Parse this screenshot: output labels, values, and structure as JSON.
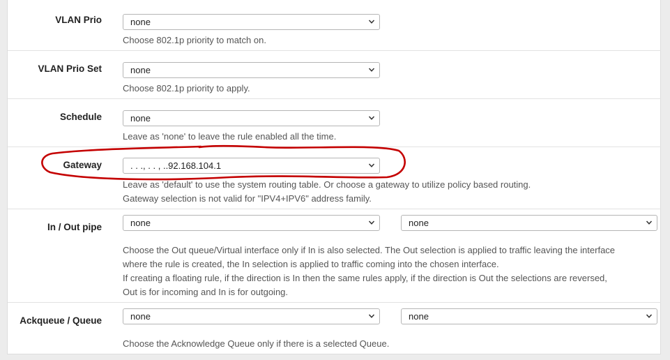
{
  "rows": {
    "vlan_prio": {
      "label": "VLAN Prio",
      "select_value": "none",
      "help": "Choose 802.1p priority to match on."
    },
    "vlan_prio_set": {
      "label": "VLAN Prio Set",
      "select_value": "none",
      "help": "Choose 802.1p priority to apply."
    },
    "schedule": {
      "label": "Schedule",
      "select_value": "none",
      "help": "Leave as 'none' to leave the rule enabled all the time."
    },
    "gateway": {
      "label": "Gateway",
      "select_value": ". . ., . . , ..92.168.104.1",
      "help_line1": "Leave as 'default' to use the system routing table. Or choose a gateway to utilize policy based routing.",
      "help_line2": "Gateway selection is not valid for \"IPV4+IPV6\" address family."
    },
    "in_out_pipe": {
      "label": "In / Out pipe",
      "in_value": "none",
      "out_value": "none",
      "help_line1": "Choose the Out queue/Virtual interface only if In is also selected. The Out selection is applied to traffic leaving the interface",
      "help_line2": "where the rule is created, the In selection is applied to traffic coming into the chosen interface.",
      "help_line3": "If creating a floating rule, if the direction is In then the same rules apply, if the direction is Out the selections are reversed,",
      "help_line4": "Out is for incoming and In is for outgoing."
    },
    "ackqueue": {
      "label": "Ackqueue / Queue",
      "ack_value": "none",
      "queue_value": "none",
      "help": "Choose the Acknowledge Queue only if there is a selected Queue."
    }
  },
  "icons": {
    "select_arrow": "chevron-down-icon"
  },
  "colors": {
    "annotation": "#c40000"
  }
}
